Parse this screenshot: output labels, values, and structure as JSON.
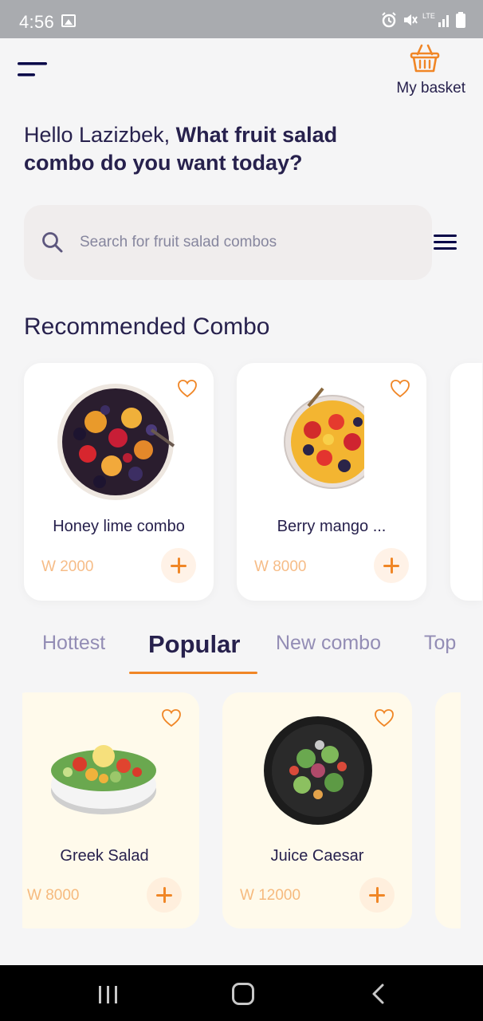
{
  "status_bar": {
    "time": "4:56"
  },
  "header": {
    "basket_label": "My basket"
  },
  "greeting": {
    "name_part": "Hello Lazizbek,",
    "question_part": " What fruit salad combo do you want today?"
  },
  "search": {
    "placeholder": "Search for fruit salad combos",
    "value": ""
  },
  "recommended": {
    "title": "Recommended Combo",
    "items": [
      {
        "name": "Honey lime combo",
        "price": "W 2000"
      },
      {
        "name": "Berry mango ...",
        "price": "W 8000"
      }
    ]
  },
  "tabs": [
    "Hottest",
    "Popular",
    "New combo",
    "Top"
  ],
  "active_tab": "Popular",
  "popular": {
    "items": [
      {
        "name": "Greek Salad",
        "price": "W 8000"
      },
      {
        "name": "Juice Caesar",
        "price": "W 12000"
      }
    ]
  },
  "colors": {
    "accent": "#f08626",
    "text_dark": "#27214d",
    "tab_inactive": "#938db5",
    "card_cream": "#fffaeb"
  },
  "icons": [
    "menu-icon",
    "basket-icon",
    "search-icon",
    "filter-icon",
    "heart-icon",
    "plus-icon",
    "recent-apps-icon",
    "home-icon",
    "back-icon"
  ]
}
